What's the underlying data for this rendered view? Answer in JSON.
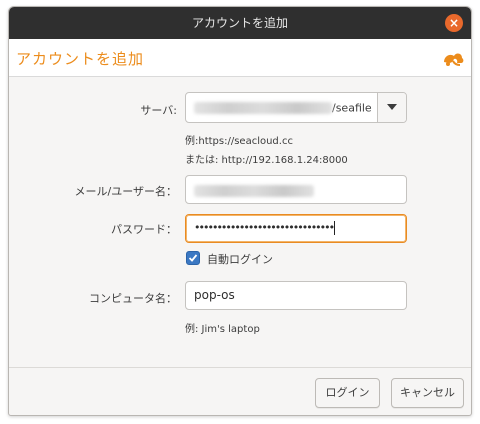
{
  "window": {
    "title": "アカウントを追加",
    "close_icon": "×"
  },
  "header": {
    "title": "アカウントを追加",
    "logo": "seafile-logo-icon"
  },
  "form": {
    "server": {
      "label": "サーバ:",
      "value_suffix": "/seafile",
      "hint_example": "例:https://seacloud.cc",
      "hint_alt": "または: http://192.168.1.24:8000"
    },
    "email": {
      "label": "メール/ユーザー名："
    },
    "password": {
      "label": "パスワード：",
      "value": "•••••••••••••••••••••••••••••••"
    },
    "auto_login": {
      "label": "自動ログイン",
      "checked": true
    },
    "computer_name": {
      "label": "コンピュータ名：",
      "value": "pop-os",
      "hint": "例: Jim's laptop"
    }
  },
  "buttons": {
    "login": "ログイン",
    "cancel": "キャンセル"
  },
  "colors": {
    "accent": "#ec8c1c",
    "checkbox": "#3b78c3",
    "titlebar": "#2f2f2f"
  }
}
